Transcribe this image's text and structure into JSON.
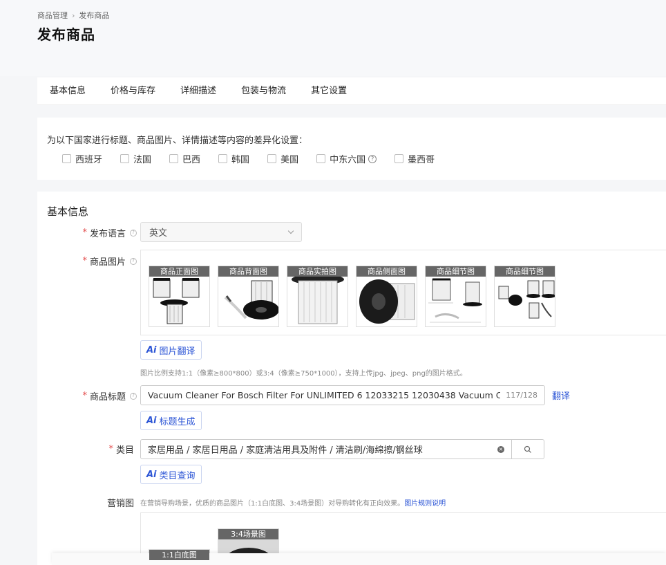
{
  "breadcrumb": {
    "root": "商品管理",
    "sep": "›",
    "current": "发布商品"
  },
  "page_title": "发布商品",
  "tabs": [
    {
      "label": "基本信息"
    },
    {
      "label": "价格与库存"
    },
    {
      "label": "详细描述"
    },
    {
      "label": "包装与物流"
    },
    {
      "label": "其它设置"
    }
  ],
  "countries": {
    "title": "为以下国家进行标题、商品图片、详情描述等内容的差异化设置：",
    "items": [
      "西班牙",
      "法国",
      "巴西",
      "韩国",
      "美国",
      "中东六国",
      "墨西哥"
    ],
    "help_glyph": "?"
  },
  "basic": {
    "section_title": "基本信息",
    "required_mark": "*",
    "help_glyph": "?",
    "language_label": "发布语言",
    "language_value": "英文",
    "images_label": "商品图片",
    "image_thumbs": [
      {
        "label": "商品正面图"
      },
      {
        "label": "商品背面图"
      },
      {
        "label": "商品实拍图"
      },
      {
        "label": "商品侧面图"
      },
      {
        "label": "商品细节图"
      },
      {
        "label": "商品细节图"
      }
    ],
    "ai_glyph": "Ai",
    "img_translate_btn": "图片翻译",
    "image_hint": "图片比例支持1:1（像素≥800*800）或3:4（像素≥750*1000），支持上传jpg、jpeg、png的图片格式。",
    "title_label": "商品标题",
    "title_value": "Vacuum Cleaner For Bosch Filter For UNLIMITED 6 12033215 12030438 Vacuum Cleaner Replacement Parts",
    "title_count": "117/128",
    "translate_link": "翻译",
    "title_gen_btn": "标题生成",
    "category_label": "类目",
    "category_value": "家居用品 / 家居日用品 / 家庭清洁用具及附件 / 清洁刷/海绵擦/钢丝球",
    "clear_glyph": "×",
    "category_query_btn": "类目查询",
    "marketing_label": "营销图",
    "marketing_hint": "在营销导购场景，优质的商品图片（1:1白底图、3:4场景图）对导购转化有正向效果。",
    "marketing_link": "图片规则说明",
    "marketing_thumbs": [
      {
        "label": "1:1白底图"
      },
      {
        "label": "3:4场景图"
      }
    ]
  }
}
